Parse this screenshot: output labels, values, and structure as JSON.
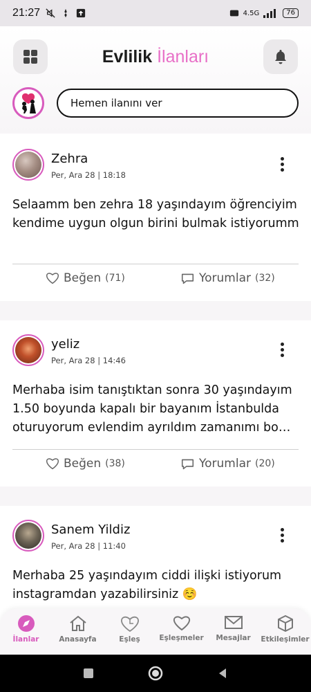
{
  "status_bar": {
    "time": "21:27",
    "network": "4.5G",
    "battery": "76"
  },
  "header": {
    "title_part1": "Evlilik ",
    "title_part2": "İlanları",
    "accent_color": "#e86fc7",
    "search_placeholder": "Hemen ilanını ver"
  },
  "posts": [
    {
      "name": "Zehra",
      "meta": "Per, Ara 28 | 18:18",
      "text": "Selaamm ben zehra 18 yaşındayım öğrenciyim kendime uygun olgun birini bulmak istiyorumm",
      "like_label": "Beğen",
      "like_count": "(71)",
      "comment_label": "Yorumlar",
      "comment_count": "(32)"
    },
    {
      "name": "yeliz",
      "meta": "Per, Ara 28 | 14:46",
      "text": "Merhaba isim tanıştıktan sonra 30 yaşındayım 1.50 boyunda kapalı bir bayanım İstanbulda oturuyorum evlendim ayrıldım zamanımı bo…",
      "like_label": "Beğen",
      "like_count": "(38)",
      "comment_label": "Yorumlar",
      "comment_count": "(20)"
    },
    {
      "name": "Sanem Yildiz",
      "meta": "Per, Ara 28 | 11:40",
      "text": "Merhaba 25 yaşındayım ciddi ilişki istiyorum instagramdan yazabilirsiniz ☺️"
    }
  ],
  "bottom_nav": [
    {
      "label": "İlanlar",
      "icon": "compass-icon",
      "active": true
    },
    {
      "label": "Anasayfa",
      "icon": "home-icon",
      "active": false
    },
    {
      "label": "Eşleş",
      "icon": "heart-puzzle-icon",
      "active": false
    },
    {
      "label": "Eşleşmeler",
      "icon": "heart-icon",
      "active": false
    },
    {
      "label": "Mesajlar",
      "icon": "envelope-icon",
      "active": false
    },
    {
      "label": "Etkileşimler",
      "icon": "box-icon",
      "active": false
    }
  ]
}
